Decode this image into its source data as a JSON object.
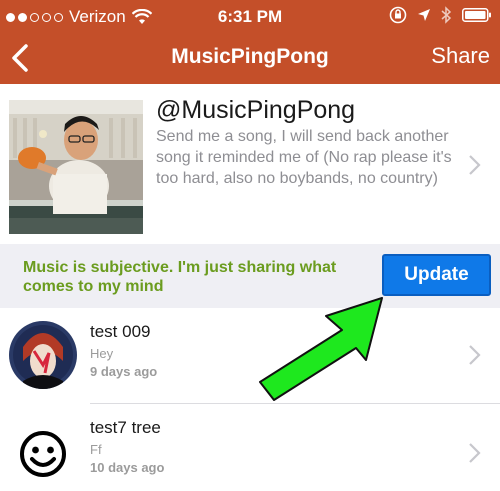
{
  "status_bar": {
    "carrier": "Verizon",
    "time": "6:31 PM",
    "signal_bars_filled": 2,
    "signal_bars_total": 5
  },
  "nav": {
    "title": "MusicPingPong",
    "share_label": "Share",
    "back_icon": "chevron-left-icon"
  },
  "profile": {
    "handle": "@MusicPingPong",
    "bio": "Send me a song, I will send back another song it reminded me of (No rap please it's too hard, also no boybands, no country)"
  },
  "banner": {
    "message": "Music is subjective. I'm just sharing what comes to my mind",
    "update_label": "Update"
  },
  "conversations": [
    {
      "name": "test 009",
      "preview": "Hey",
      "time_ago": "9 days ago",
      "avatar": "portrait-photo"
    },
    {
      "name": "test7 tree",
      "preview": "Ff",
      "time_ago": "10 days ago",
      "avatar": "smiley-face-icon"
    }
  ],
  "colors": {
    "nav_background": "#c44f29",
    "banner_text": "#6b9c1f",
    "update_button": "#0f79e8",
    "annotation_arrow": "#1ee81e"
  }
}
